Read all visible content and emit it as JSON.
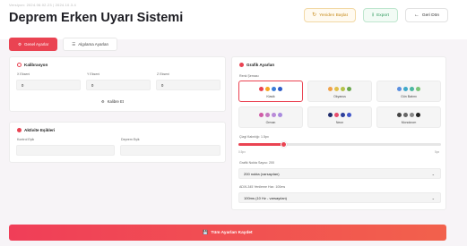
{
  "header": {
    "meta": "Versiyon: 2024.06.02.23 | 2024.10.3.4",
    "title": "Deprem Erken Uyarı Sistemi",
    "buttons": {
      "restart": "Yeniden Başlat",
      "export": "Export",
      "back": "Geri Dön"
    }
  },
  "tabs": [
    {
      "label": "Genel Ayarlar",
      "active": true
    },
    {
      "label": "Algılama Ayarları",
      "active": false
    }
  ],
  "calibration": {
    "title": "Kalibrasyon",
    "fields": [
      {
        "label": "X Ekseni",
        "value": "0"
      },
      {
        "label": "Y Ekseni",
        "value": "0"
      },
      {
        "label": "Z Ekseni",
        "value": "0"
      }
    ],
    "calibrate_button": "Kalibre Et"
  },
  "activity": {
    "title": "Aktivite Eşikleri",
    "fields": [
      {
        "label": "Kontrol Eşik",
        "value": ""
      },
      {
        "label": "Deprem Eşik",
        "value": ""
      }
    ]
  },
  "graph": {
    "title": "Grafik Ayarları",
    "theme_label": "Renk Şeması",
    "themes": [
      {
        "name": "Klasik",
        "selected": true,
        "colors": [
          "#ea4352",
          "#f5a623",
          "#3b7dd8",
          "#2d5bc7"
        ]
      },
      {
        "name": "Okyanus",
        "selected": false,
        "colors": [
          "#f0a24a",
          "#e0c04b",
          "#b5c24a",
          "#6aa84f"
        ]
      },
      {
        "name": "Gün Batımı",
        "selected": false,
        "colors": [
          "#5a8fe0",
          "#3fa9c9",
          "#4cb7a1",
          "#7cc576"
        ]
      },
      {
        "name": "Orman",
        "selected": false,
        "colors": [
          "#d05ba6",
          "#c57ac1",
          "#b98ad8",
          "#a98bde"
        ]
      },
      {
        "name": "Neon",
        "selected": false,
        "colors": [
          "#1f2b6b",
          "#e84c6c",
          "#2d3f9b",
          "#4257c9"
        ]
      },
      {
        "name": "Monokrom",
        "selected": false,
        "colors": [
          "#444444",
          "#666666",
          "#888888",
          "#222222"
        ]
      }
    ],
    "line_label": "Çizgi Kalınlığı: 1.5px",
    "line_min": "0.5px",
    "line_max": "5px",
    "line_fraction": 0.22,
    "points_label": "Grafik Nokta Sayısı: 200",
    "points_value": "200 nokta (varsayılan)",
    "interval_label": "ADXL345 Yenileme Hızı: 100ms",
    "interval_value": "100ms (10 Hz - varsayılan)"
  },
  "save_button": "Tüm Ayarları Kaydet",
  "colors": {
    "accent": "#ea4352"
  }
}
